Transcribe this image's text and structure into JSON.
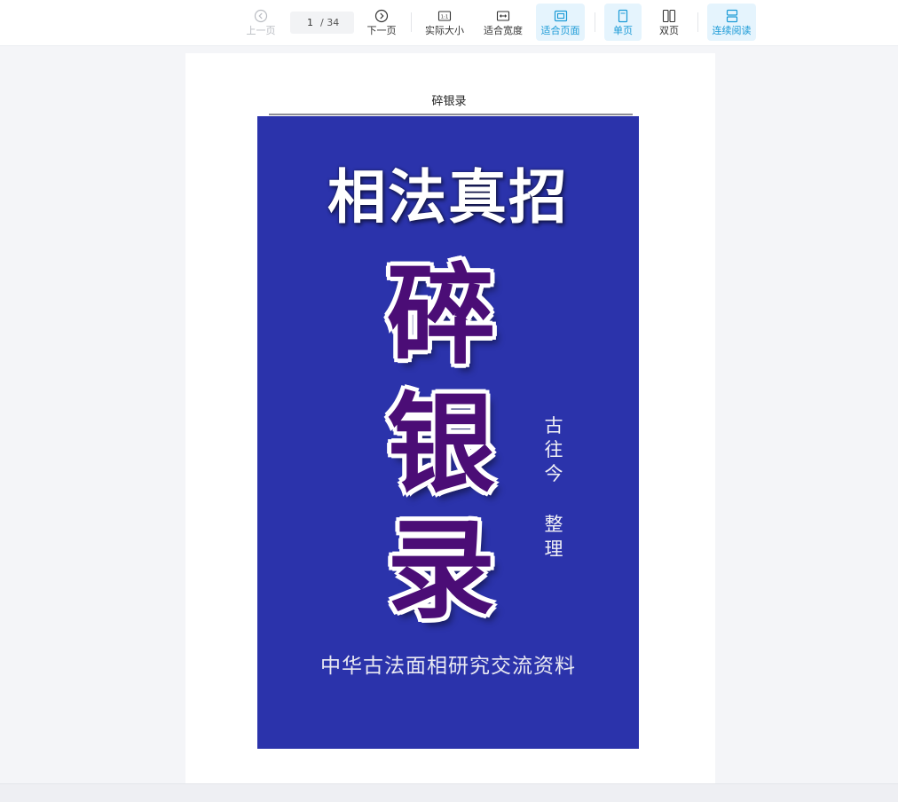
{
  "toolbar": {
    "prev_label": "上一页",
    "next_label": "下一页",
    "page": {
      "current": "1",
      "total": "/ 34"
    },
    "actual_size_label": "实际大小",
    "fit_width_label": "适合宽度",
    "fit_page_label": "适合页面",
    "single_page_label": "单页",
    "double_page_label": "双页",
    "continuous_label": "连续阅读",
    "accent_color": "#1a9ad6"
  },
  "document": {
    "running_header": "碎银录",
    "cover": {
      "background_color": "#2b33ab",
      "subtitle": "相法真招",
      "title_chars": [
        "碎",
        "银",
        "录"
      ],
      "side_text": [
        "古",
        "往",
        "今",
        "整",
        "理"
      ],
      "footer": "中华古法面相研究交流资料"
    }
  }
}
